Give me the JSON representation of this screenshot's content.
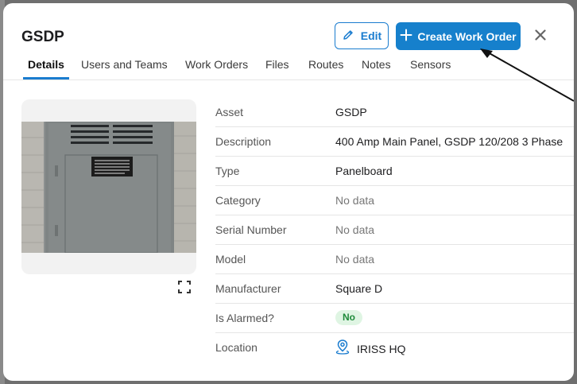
{
  "asset": {
    "title": "GSDP"
  },
  "header": {
    "edit_label": "Edit",
    "create_label": "Create Work Order"
  },
  "tabs": [
    "Details",
    "Users and Teams",
    "Work Orders",
    "Files",
    "Routes",
    "Notes",
    "Sensors"
  ],
  "active_tab": "Details",
  "details": [
    {
      "label": "Asset",
      "value": "GSDP"
    },
    {
      "label": "Description",
      "value": "400 Amp Main Panel, GSDP 120/208 3 Phase"
    },
    {
      "label": "Type",
      "value": "Panelboard"
    },
    {
      "label": "Category",
      "value": "No data"
    },
    {
      "label": "Serial Number",
      "value": "No data"
    },
    {
      "label": "Model",
      "value": "No data"
    },
    {
      "label": "Manufacturer",
      "value": "Square D"
    },
    {
      "label": "Is Alarmed?",
      "value": "No"
    },
    {
      "label": "Location",
      "value": "IRISS HQ"
    }
  ],
  "colors": {
    "accent": "#1680cc",
    "badge_bg": "#dff5e3",
    "badge_text": "#1e8a3a"
  },
  "icons": {
    "edit": "pencil-icon",
    "create": "plus-icon",
    "close": "close-icon",
    "expand": "expand-icon",
    "location": "map-pin-icon"
  }
}
